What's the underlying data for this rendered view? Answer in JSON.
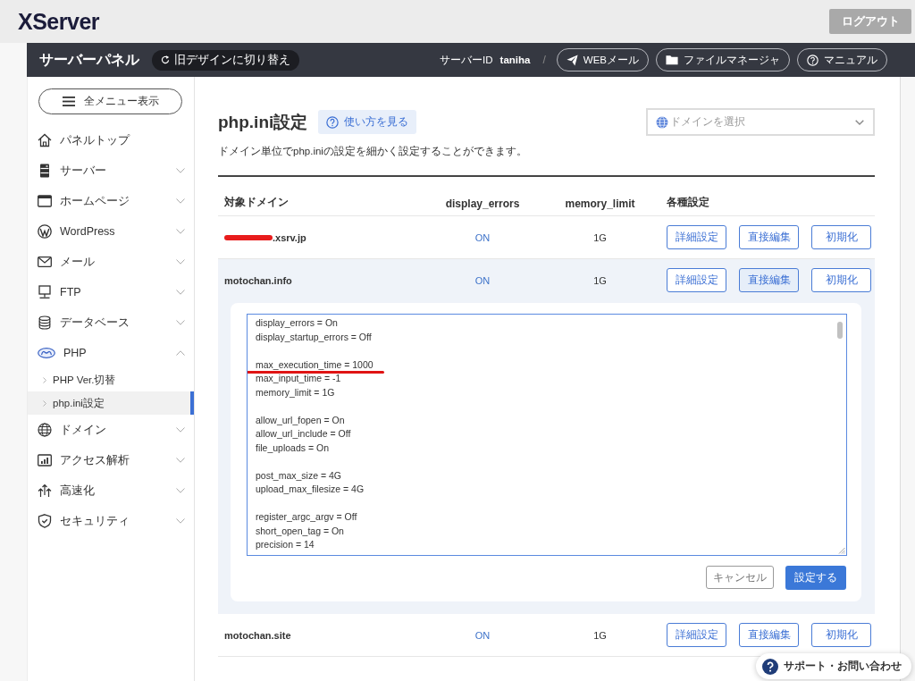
{
  "header": {
    "logo": "XServer",
    "logout": "ログアウト"
  },
  "panel_bar": {
    "title": "サーバーパネル",
    "design_switch": "旧デザインに切り替え",
    "server_id_label": "サーバーID",
    "server_id": "taniha",
    "separator": "/",
    "links": [
      "WEBメール",
      "ファイルマネージャ",
      "マニュアル"
    ]
  },
  "sidebar": {
    "menu_button": "全メニュー表示",
    "items": [
      {
        "label": "パネルトップ",
        "kind": "link"
      },
      {
        "label": "サーバー",
        "kind": "group",
        "expanded": false
      },
      {
        "label": "ホームページ",
        "kind": "group",
        "expanded": false
      },
      {
        "label": "WordPress",
        "kind": "group",
        "expanded": false
      },
      {
        "label": "メール",
        "kind": "group",
        "expanded": false
      },
      {
        "label": "FTP",
        "kind": "group",
        "expanded": false
      },
      {
        "label": "データベース",
        "kind": "group",
        "expanded": false
      },
      {
        "label": "PHP",
        "kind": "group",
        "expanded": true,
        "children": [
          {
            "label": "PHP Ver.切替",
            "selected": false
          },
          {
            "label": "php.ini設定",
            "selected": true
          }
        ]
      },
      {
        "label": "ドメイン",
        "kind": "group",
        "expanded": false
      },
      {
        "label": "アクセス解析",
        "kind": "group",
        "expanded": false
      },
      {
        "label": "高速化",
        "kind": "group",
        "expanded": false
      },
      {
        "label": "セキュリティ",
        "kind": "group",
        "expanded": false
      }
    ]
  },
  "page": {
    "title": "php.ini設定",
    "help_button": "使い方を見る",
    "domain_select": {
      "placeholder": "ドメインを選択"
    },
    "description": "ドメイン単位でphp.iniの設定を細かく設定することができます。"
  },
  "table": {
    "columns": [
      "対象ドメイン",
      "display_errors",
      "memory_limit",
      "各種設定"
    ],
    "rows": [
      {
        "domain": ".xsrv.jp",
        "redacted": true,
        "display_errors": "ON",
        "memory_limit": "1G",
        "expanded": false,
        "actions": [
          {
            "label": "詳細設定",
            "selected": false
          },
          {
            "label": "直接編集",
            "selected": false
          },
          {
            "label": "初期化",
            "selected": false
          }
        ]
      },
      {
        "domain": "motochan.info",
        "redacted": false,
        "display_errors": "ON",
        "memory_limit": "1G",
        "expanded": true,
        "actions": [
          {
            "label": "詳細設定",
            "selected": false
          },
          {
            "label": "直接編集",
            "selected": true
          },
          {
            "label": "初期化",
            "selected": false
          }
        ],
        "editor": {
          "sections": [
            {
              "lines": [
                {
                  "text": "display_errors = On",
                  "underlined": false
                },
                {
                  "text": "display_startup_errors = Off",
                  "underlined": false
                }
              ]
            },
            {
              "lines": [
                {
                  "text": "max_execution_time = 1000",
                  "underlined": true
                },
                {
                  "text": "max_input_time = -1",
                  "underlined": false
                },
                {
                  "text": "memory_limit = 1G",
                  "underlined": false
                }
              ]
            },
            {
              "lines": [
                {
                  "text": "allow_url_fopen = On",
                  "underlined": false
                },
                {
                  "text": "allow_url_include = Off",
                  "underlined": false
                },
                {
                  "text": "file_uploads = On",
                  "underlined": false
                }
              ]
            },
            {
              "lines": [
                {
                  "text": "post_max_size = 4G",
                  "underlined": false
                },
                {
                  "text": "upload_max_filesize = 4G",
                  "underlined": false
                }
              ]
            },
            {
              "lines": [
                {
                  "text": "register_argc_argv = Off",
                  "underlined": false
                },
                {
                  "text": "short_open_tag = On",
                  "underlined": false
                },
                {
                  "text": "precision = 14",
                  "underlined": false
                }
              ]
            }
          ],
          "buttons": [
            {
              "label": "キャンセル",
              "kind": "secondary"
            },
            {
              "label": "設定する",
              "kind": "primary"
            }
          ]
        }
      },
      {
        "domain": "motochan.site",
        "redacted": false,
        "display_errors": "ON",
        "memory_limit": "1G",
        "expanded": false,
        "actions": [
          {
            "label": "詳細設定",
            "selected": false
          },
          {
            "label": "直接編集",
            "selected": false
          },
          {
            "label": "初期化",
            "selected": false
          }
        ]
      }
    ]
  },
  "support_button": "サポート・お問い合わせ"
}
